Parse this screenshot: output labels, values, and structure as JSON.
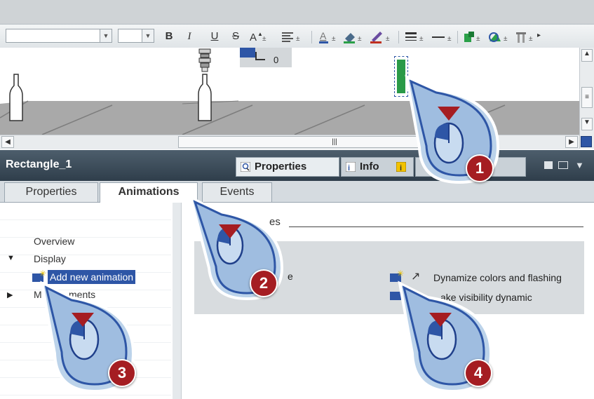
{
  "toolbar": {
    "icons": [
      "bold-icon",
      "italic-icon",
      "underline-icon",
      "strikethrough-icon",
      "font-size-icon",
      "align-icon",
      "font-color-icon",
      "fill-color-icon",
      "line-color-icon",
      "line-width-icon",
      "line-style-icon",
      "color-icon",
      "rotate-icon",
      "pattern-icon"
    ],
    "bold": "B",
    "italic": "I",
    "underline": "U",
    "strike": "S"
  },
  "canvas": {
    "io_field_value": "0"
  },
  "inspector": {
    "title": "Rectangle_1",
    "tabs": {
      "properties": "Properties",
      "info": "Info"
    }
  },
  "subtabs": {
    "properties": "Properties",
    "animations": "Animations",
    "events": "Events"
  },
  "tree": {
    "overview": "Overview",
    "display": "Display",
    "add_new": "Add new animation",
    "movements": "M",
    "movements_rest": "ments"
  },
  "panel": {
    "group_title_tail": "es",
    "item_partial": "e",
    "dynamize": "Dynamize colors and flashing",
    "visibility": "ake visibility dynamic"
  },
  "callouts": [
    "1",
    "2",
    "3",
    "4"
  ],
  "colors": {
    "accent_red": "#a51d22",
    "selection_blue": "#2e56a6",
    "header_dark": "#3a4a57"
  }
}
